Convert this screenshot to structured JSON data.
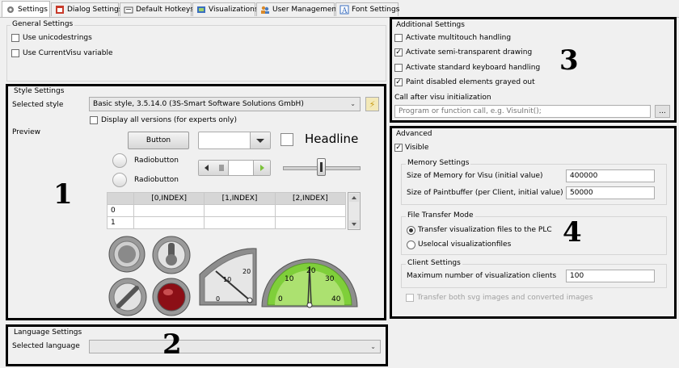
{
  "tabs": [
    {
      "label": "Settings",
      "icon": "settings-icon"
    },
    {
      "label": "Dialog Settings",
      "icon": "dialog-icon"
    },
    {
      "label": "Default Hotkeys",
      "icon": "keyboard-icon"
    },
    {
      "label": "Visualizations",
      "icon": "visualization-icon"
    },
    {
      "label": "User Management",
      "icon": "users-icon"
    },
    {
      "label": "Font Settings",
      "icon": "font-icon"
    }
  ],
  "general": {
    "title": "General Settings",
    "unicode": "Use unicodestrings",
    "currentvisu": "Use CurrentVisu variable"
  },
  "style": {
    "title": "Style Settings",
    "selected_label": "Selected style",
    "selected_value": "Basic style, 3.5.14.0 (3S-Smart Software Solutions GmbH)",
    "display_all": "Display all versions (for experts only)",
    "preview_label": "Preview"
  },
  "preview": {
    "button": "Button",
    "headline": "Headline",
    "radio1": "Radiobutton",
    "radio2": "Radiobutton",
    "table_headers": [
      "[0,INDEX]",
      "[1,INDEX]",
      "[2,INDEX]"
    ],
    "row_labels": [
      "0",
      "1"
    ],
    "gauge1_ticks": [
      "0",
      "10",
      "20"
    ],
    "gauge2_ticks": [
      "0",
      "10",
      "20",
      "30",
      "40"
    ]
  },
  "language": {
    "title": "Language Settings",
    "selected_label": "Selected language",
    "selected_value": ""
  },
  "additional": {
    "title": "Additional Settings",
    "multitouch": "Activate multitouch handling",
    "semitransparent": "Activate semi-transparent drawing",
    "keyboard": "Activate standard keyboard handling",
    "grayed": "Paint disabled elements grayed out",
    "call_after": "Call after visu initialization",
    "call_placeholder": "Program or function call, e.g. VisuInit();",
    "browse": "..."
  },
  "advanced": {
    "title": "Advanced",
    "visible": "Visible"
  },
  "memory": {
    "title": "Memory Settings",
    "visu_label": "Size of Memory for Visu (initial value)",
    "visu_value": "400000",
    "paint_label": "Size of Paintbuffer (per Client, initial value)",
    "paint_value": "50000"
  },
  "filetransfer": {
    "title": "File Transfer Mode",
    "opt1": "Transfer visualization files to the PLC",
    "opt2": "Uselocal visualizationfiles"
  },
  "client": {
    "title": "Client Settings",
    "max_label": "Maximum number of visualization clients",
    "max_value": "100",
    "svg_label": "Transfer both svg images and converted images"
  },
  "annotations": {
    "n1": "1",
    "n2": "2",
    "n3": "3",
    "n4": "4"
  }
}
